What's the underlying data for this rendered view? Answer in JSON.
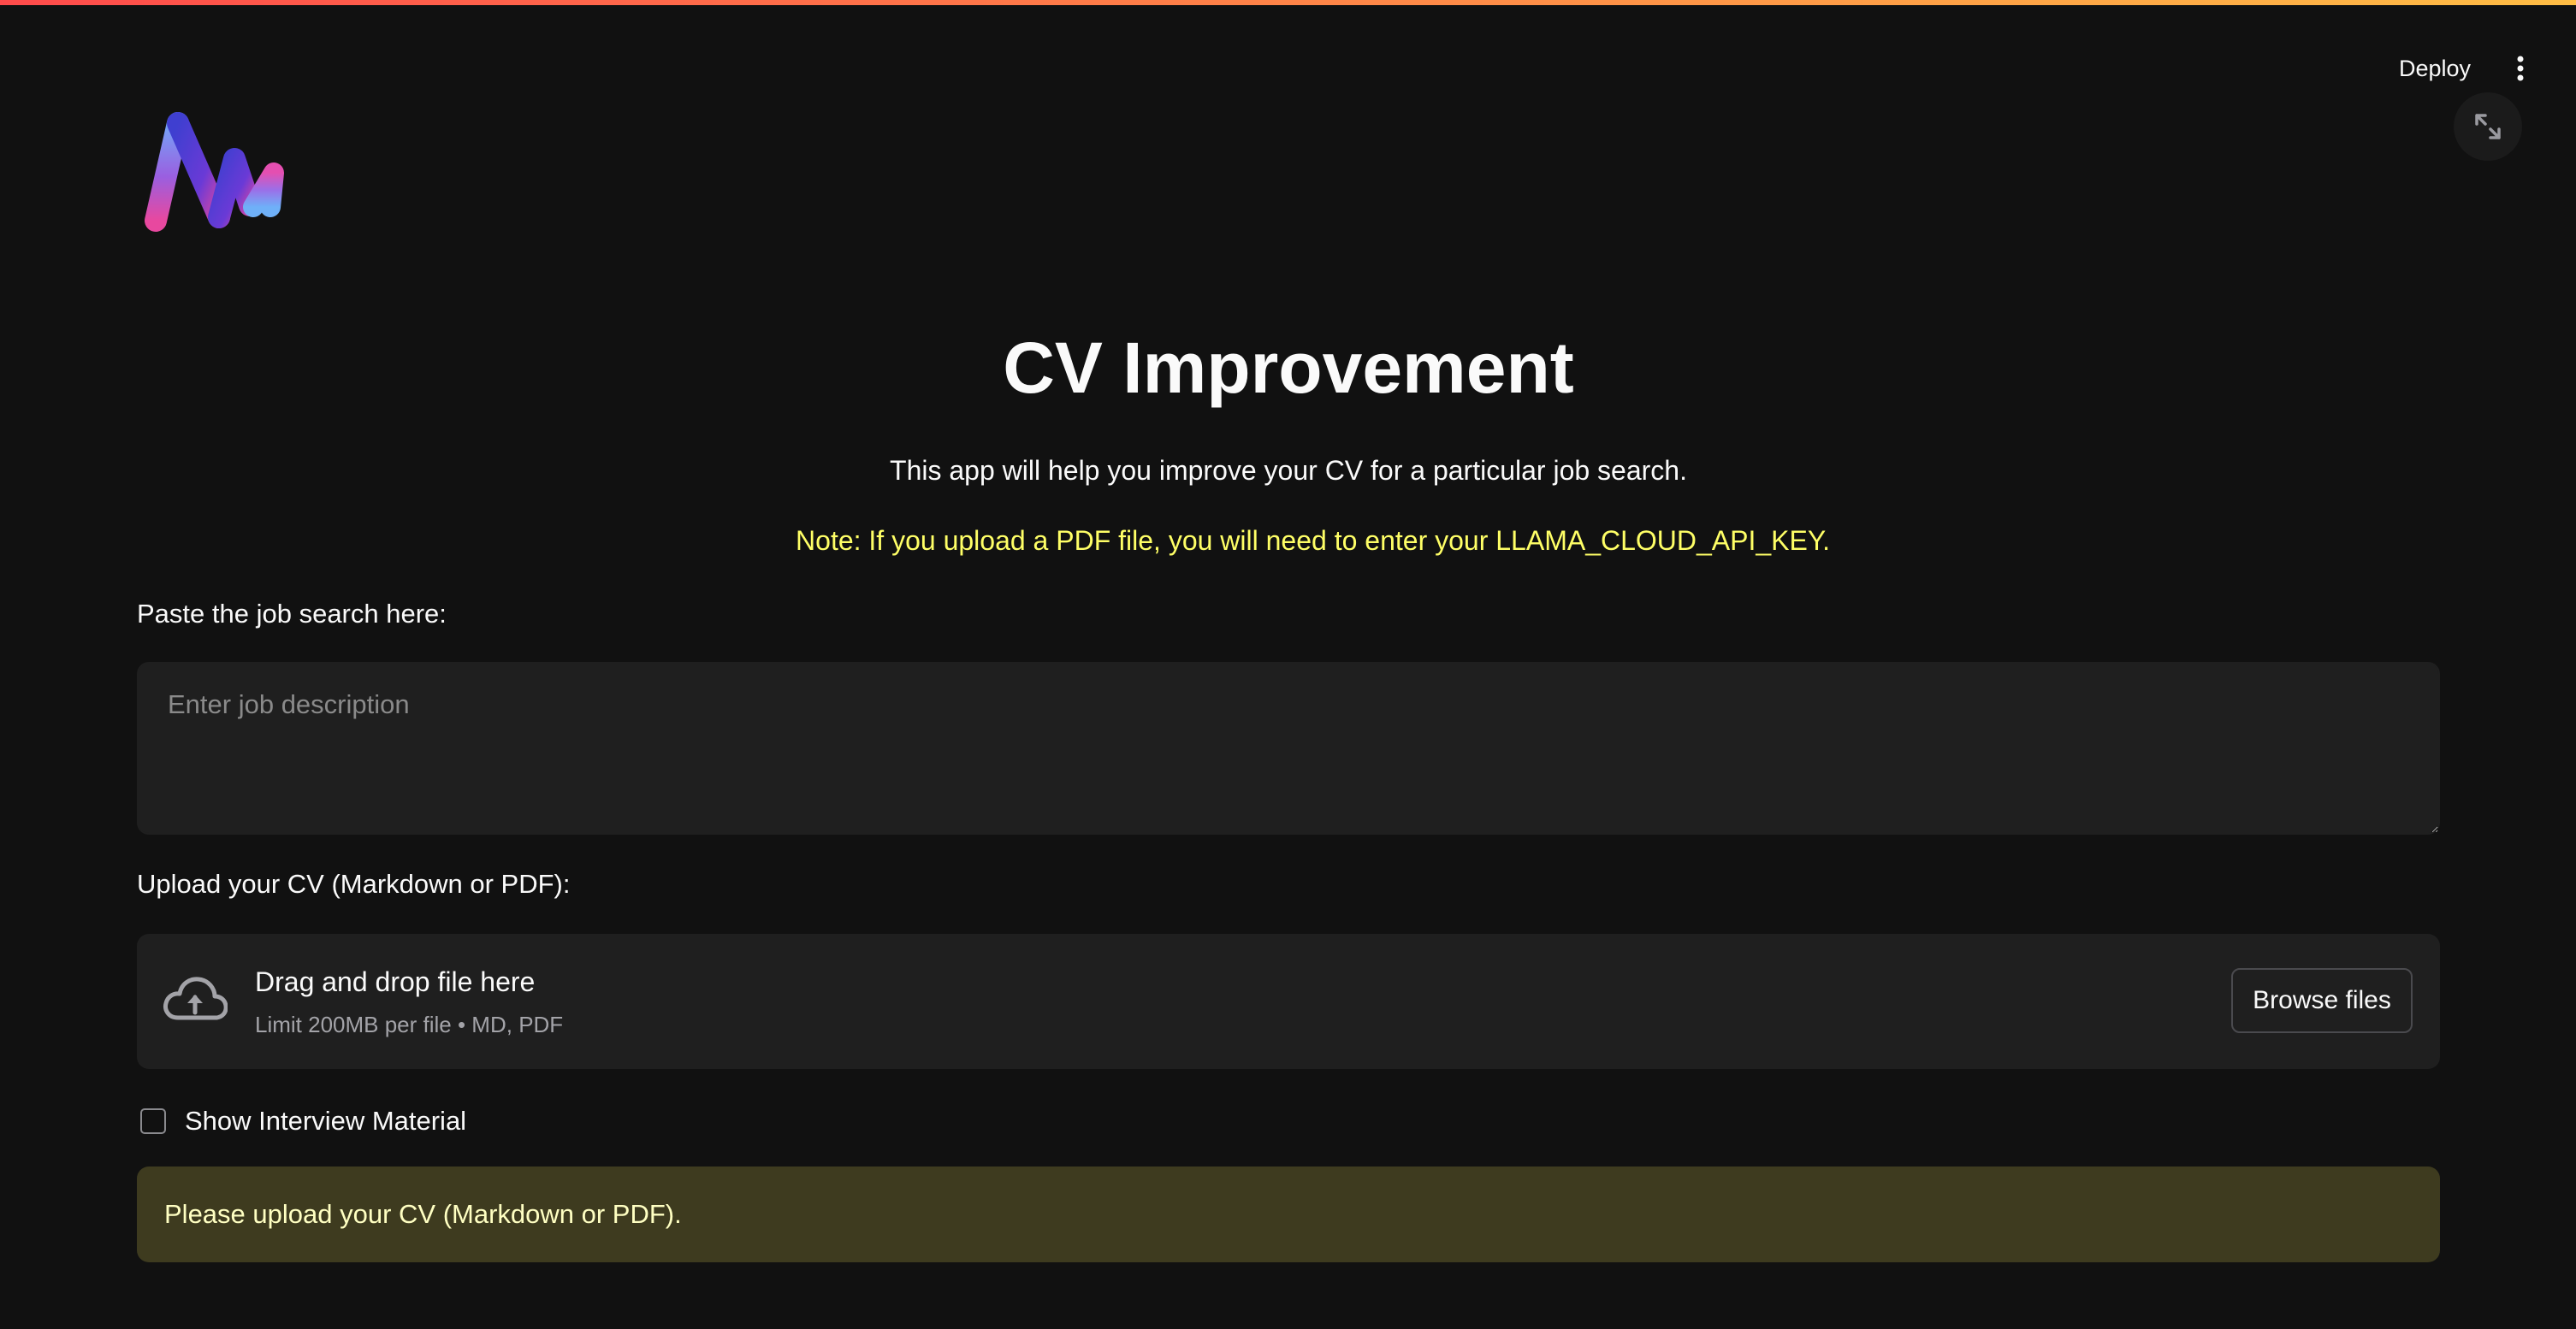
{
  "header": {
    "deploy_label": "Deploy",
    "menu_icon": "kebab-vertical-icon",
    "expand_icon": "fullscreen-expand-icon"
  },
  "logo": {
    "icon": "app-logo-m",
    "colors": [
      "#6f9ff7",
      "#5b3fd6",
      "#e44fb1"
    ]
  },
  "main": {
    "title": "CV Improvement",
    "subtitle": "This app will help you improve your CV for a particular job search.",
    "note": "Note: If you upload a PDF file, you will need to enter your LLAMA_CLOUD_API_KEY.",
    "job_search": {
      "label": "Paste the job search here:",
      "placeholder": "Enter job description",
      "value": ""
    },
    "upload": {
      "label": "Upload your CV (Markdown or PDF):",
      "drop_text": "Drag and drop file here",
      "limit_text": "Limit 200MB per file • MD, PDF",
      "browse_label": "Browse files",
      "icon": "cloud-upload-icon"
    },
    "interview_checkbox": {
      "label": "Show Interview Material",
      "checked": false
    },
    "warning": "Please upload your CV (Markdown or PDF)."
  },
  "colors": {
    "background": "#111111",
    "note_yellow": "#ffff66",
    "warning_bg": "#3e3b1f",
    "warning_text": "#ffffc2",
    "accent_stripe_start": "#ff4b4b",
    "accent_stripe_end": "#ffbd45"
  }
}
